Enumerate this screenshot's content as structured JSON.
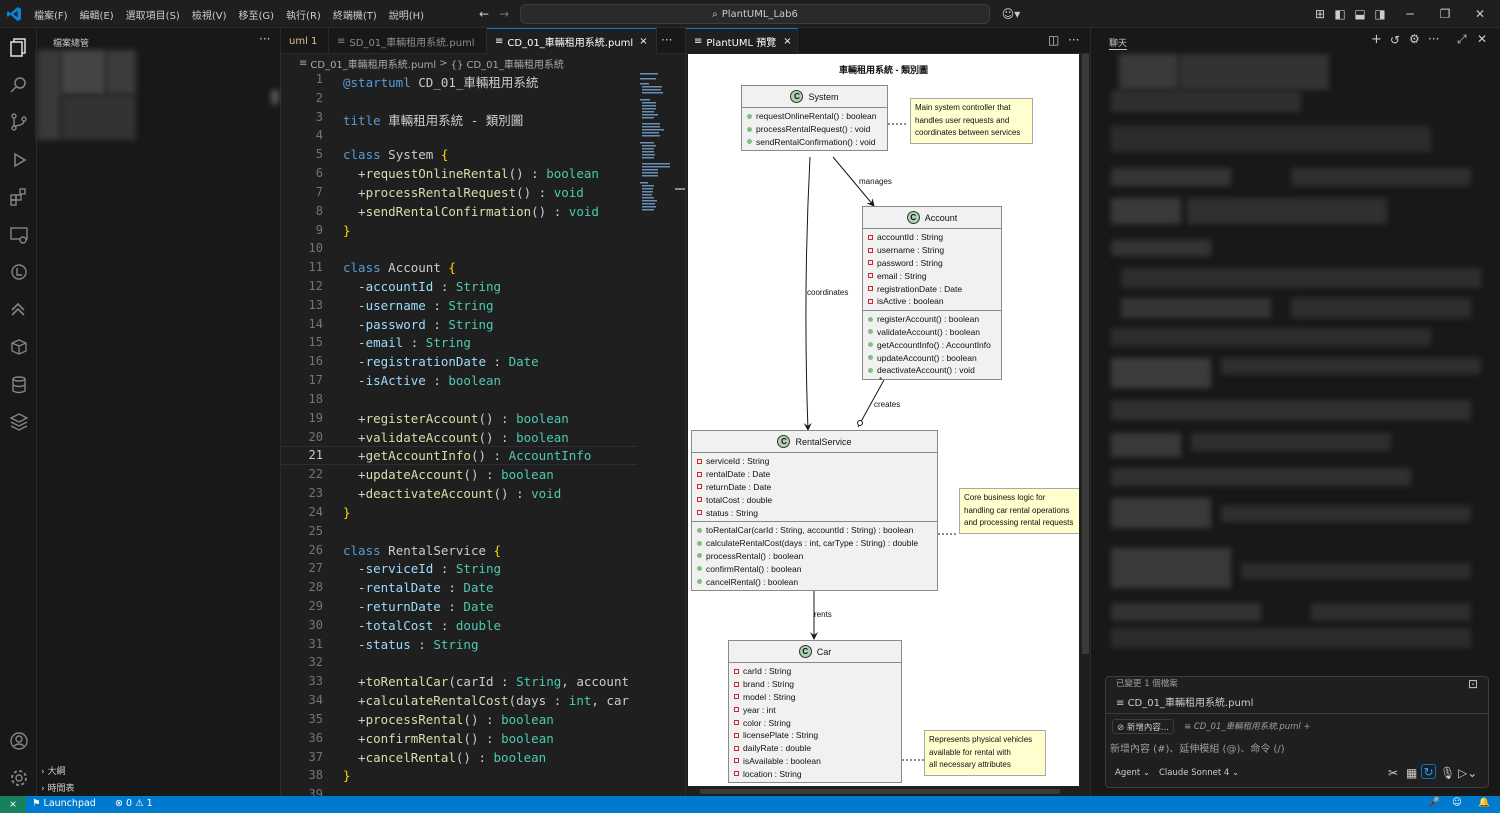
{
  "menu": [
    "檔案(F)",
    "編輯(E)",
    "選取項目(S)",
    "檢視(V)",
    "移至(G)",
    "執行(R)",
    "終端機(T)",
    "說明(H)"
  ],
  "command_center": "PlantUML_Lab6",
  "sidebar": {
    "header": "檔案總管",
    "footer": [
      {
        "label": "大綱"
      },
      {
        "label": "時間表"
      }
    ]
  },
  "editor": {
    "tabs": [
      {
        "label": "uml 1"
      },
      {
        "label": "SD_01_車輛租用系統.puml"
      },
      {
        "label": "CD_01_車輛租用系統.puml",
        "close": "×"
      }
    ],
    "breadcrumb": {
      "file": "CD_01_車輛租用系統.puml",
      "sep": ">",
      "symbol": "{} CD_01_車輛租用系統"
    },
    "current_line": "21"
  },
  "code_lines": [
    {
      "n": "1",
      "t": "@startuml CD_01_車輛租用系統"
    },
    {
      "n": "2",
      "t": ""
    },
    {
      "n": "3",
      "t": "title 車輛租用系統 - 類別圖"
    },
    {
      "n": "4",
      "t": ""
    },
    {
      "n": "5",
      "t": "class System {"
    },
    {
      "n": "6",
      "t": "  +requestOnlineRental() : boolean"
    },
    {
      "n": "7",
      "t": "  +processRentalRequest() : void"
    },
    {
      "n": "8",
      "t": "  +sendRentalConfirmation() : void"
    },
    {
      "n": "9",
      "t": "}"
    },
    {
      "n": "10",
      "t": ""
    },
    {
      "n": "11",
      "t": "class Account {"
    },
    {
      "n": "12",
      "t": "  -accountId : String"
    },
    {
      "n": "13",
      "t": "  -username : String"
    },
    {
      "n": "14",
      "t": "  -password : String"
    },
    {
      "n": "15",
      "t": "  -email : String"
    },
    {
      "n": "16",
      "t": "  -registrationDate : Date"
    },
    {
      "n": "17",
      "t": "  -isActive : boolean"
    },
    {
      "n": "18",
      "t": ""
    },
    {
      "n": "19",
      "t": "  +registerAccount() : boolean"
    },
    {
      "n": "20",
      "t": "  +validateAccount() : boolean"
    },
    {
      "n": "21",
      "t": "  +getAccountInfo() : AccountInfo"
    },
    {
      "n": "22",
      "t": "  +updateAccount() : boolean"
    },
    {
      "n": "23",
      "t": "  +deactivateAccount() : void"
    },
    {
      "n": "24",
      "t": "}"
    },
    {
      "n": "25",
      "t": ""
    },
    {
      "n": "26",
      "t": "class RentalService {"
    },
    {
      "n": "27",
      "t": "  -serviceId : String"
    },
    {
      "n": "28",
      "t": "  -rentalDate : Date"
    },
    {
      "n": "29",
      "t": "  -returnDate : Date"
    },
    {
      "n": "30",
      "t": "  -totalCost : double"
    },
    {
      "n": "31",
      "t": "  -status : String"
    },
    {
      "n": "32",
      "t": ""
    },
    {
      "n": "33",
      "t": "  +toRentalCar(carId : String, account"
    },
    {
      "n": "34",
      "t": "  +calculateRentalCost(days : int, car"
    },
    {
      "n": "35",
      "t": "  +processRental() : boolean"
    },
    {
      "n": "36",
      "t": "  +confirmRental() : boolean"
    },
    {
      "n": "37",
      "t": "  +cancelRental() : boolean"
    },
    {
      "n": "38",
      "t": "}"
    },
    {
      "n": "39",
      "t": ""
    }
  ],
  "preview": {
    "tab_label": "PlantUML 預覽",
    "tab_close": "×",
    "diagram_title": "車輛租用系統 - 類別圖",
    "classes": {
      "system": {
        "name": "System",
        "icon": "C",
        "methods": [
          "requestOnlineRental() : boolean",
          "processRentalRequest() : void",
          "sendRentalConfirmation() : void"
        ]
      },
      "account": {
        "name": "Account",
        "icon": "C",
        "fields": [
          "accountId : String",
          "username : String",
          "password : String",
          "email : String",
          "registrationDate : Date",
          "isActive : boolean"
        ],
        "methods": [
          "registerAccount() : boolean",
          "validateAccount() : boolean",
          "getAccountInfo() : AccountInfo",
          "updateAccount() : boolean",
          "deactivateAccount() : void"
        ]
      },
      "rental": {
        "name": "RentalService",
        "icon": "C",
        "fields": [
          "serviceId : String",
          "rentalDate : Date",
          "returnDate : Date",
          "totalCost : double",
          "status : String"
        ],
        "methods": [
          "toRentalCar(carId : String, accountId : String) : boolean",
          "calculateRentalCost(days : int, carType : String) : double",
          "processRental() : boolean",
          "confirmRental() : boolean",
          "cancelRental() : boolean"
        ]
      },
      "car": {
        "name": "Car",
        "icon": "C",
        "fields": [
          "carId : String",
          "brand : String",
          "model : String",
          "year : int",
          "color : String",
          "licensePlate : String",
          "dailyRate : double",
          "isAvailable : boolean",
          "location : String"
        ]
      }
    },
    "notes": {
      "system": [
        "Main system controller that",
        "handles user requests and",
        "coordinates between services"
      ],
      "rental": [
        "Core business logic for",
        "handling car rental operations",
        "and processing rental requests"
      ],
      "car": [
        "Represents physical vehicles",
        "available for rental with",
        "all necessary attributes"
      ]
    },
    "relations": {
      "manages": "manages",
      "coordinates": "coordinates",
      "creates": "creates",
      "rents": "rents",
      "star": "*",
      "one": "1"
    }
  },
  "chat": {
    "title": "聊天",
    "context_label": "已變更 1 個檔案",
    "changed_file": "CD_01_車輛租用系統.puml",
    "add_context": "新增內容...",
    "attached_file": "CD_01_車輛租用系統.puml",
    "input_placeholder": "新增內容 (#)、延伸模組 (@)、命令 (/)",
    "mode": "Agent",
    "model": "Claude Sonnet 4"
  },
  "status": {
    "launchpad": "Launchpad",
    "errors": "0",
    "warnings": "1"
  },
  "colors": {
    "accent": "#007acc",
    "editor_bg": "#1f1f1f",
    "class_icon": "#add1b2",
    "note_bg": "#fefece"
  }
}
